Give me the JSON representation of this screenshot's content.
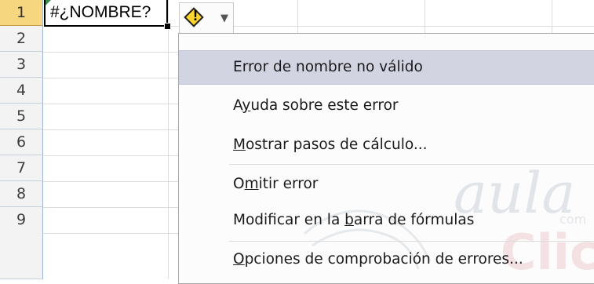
{
  "rows": [
    "1",
    "2",
    "3",
    "4",
    "5",
    "6",
    "7",
    "8",
    "9"
  ],
  "active_cell": {
    "value": "#¿NOMBRE?"
  },
  "error_button": {
    "icon": "warning-diamond-icon",
    "dropdown_icon": "chevron-down-icon"
  },
  "menu": {
    "items": [
      {
        "text": "Error de nombre no válido",
        "highlighted": true
      },
      {
        "pre": "A",
        "key": "y",
        "post": "uda sobre este error"
      },
      {
        "pre": "",
        "key": "M",
        "post": "ostrar pasos de cálculo..."
      },
      {
        "pre": "O",
        "key": "m",
        "post": "itir error"
      },
      {
        "pre": "Modificar en la ",
        "key": "b",
        "post": "arra de fórmulas"
      },
      {
        "pre": "",
        "key": "O",
        "post": "pciones de comprobación de errores..."
      }
    ]
  },
  "watermark": {
    "brand": "aula",
    "brand2": "Clic",
    "sub": "com"
  },
  "colors": {
    "selected_row_header": "#f6d77f",
    "menu_highlight": "#d2d4e2",
    "warning": "#ffd52e"
  }
}
